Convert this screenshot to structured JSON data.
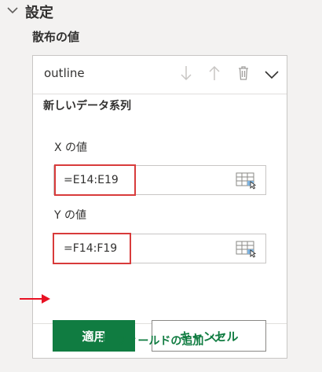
{
  "section": {
    "title": "設定"
  },
  "scatter_values_label": "散布の値",
  "series": {
    "name": "outline"
  },
  "new_series": {
    "title": "新しいデータ系列",
    "x_label": "X の値",
    "x_value": "=E14:E19",
    "y_label": "Y の値",
    "y_value": "=F14:F19"
  },
  "buttons": {
    "apply": "適用",
    "cancel": "キャンセル"
  },
  "add_field": {
    "label": "フィールドの追加"
  },
  "colors": {
    "accent": "#107c41",
    "highlight": "#d83b3b",
    "arrow": "#e81123"
  }
}
